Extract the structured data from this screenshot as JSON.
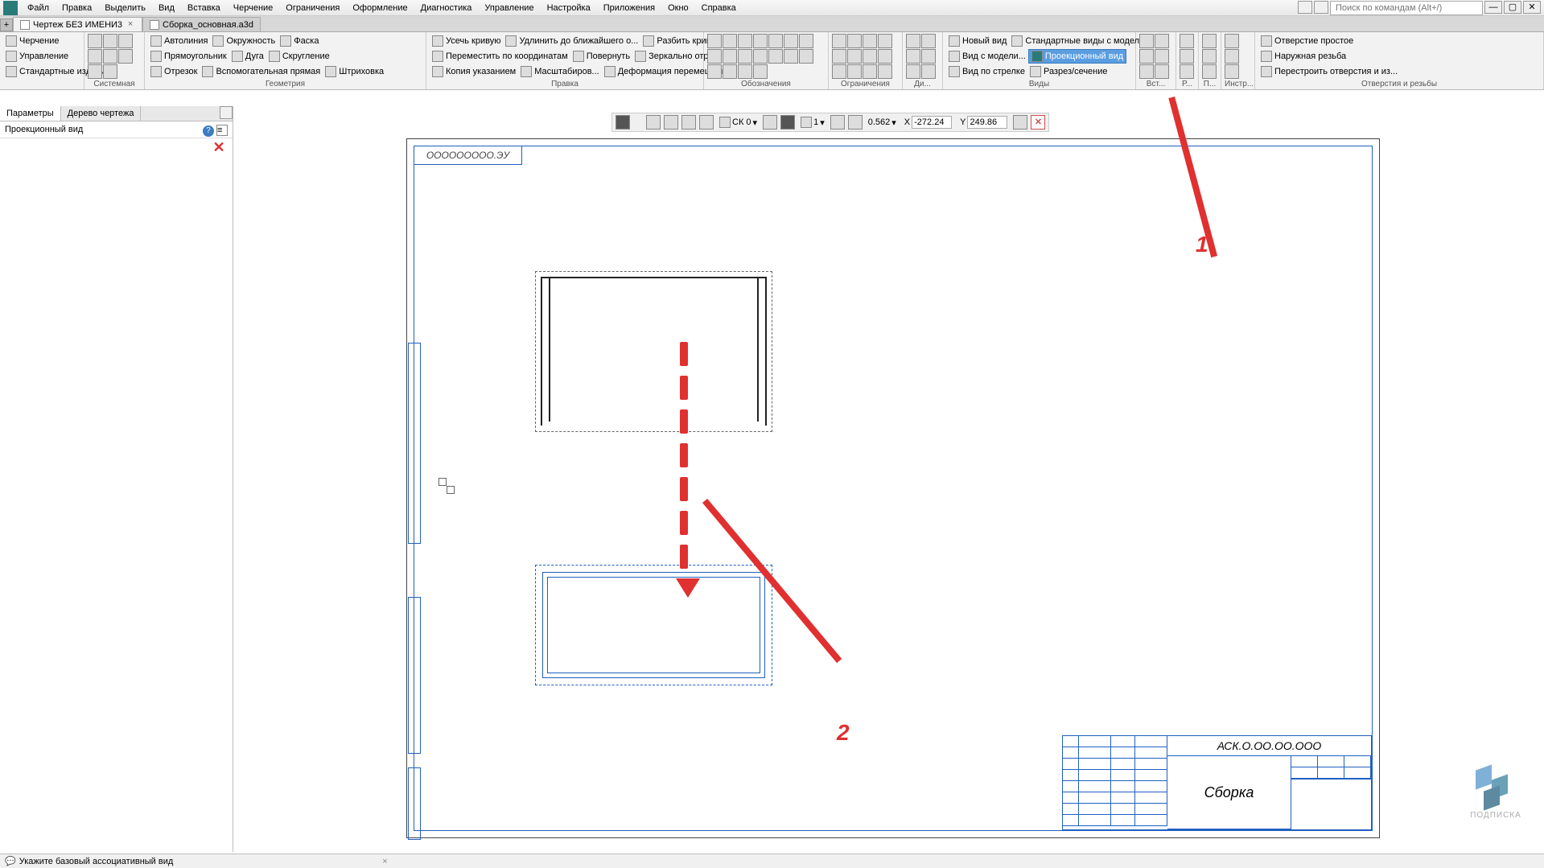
{
  "menu": {
    "file": "Файл",
    "edit": "Правка",
    "select": "Выделить",
    "view": "Вид",
    "insert": "Вставка",
    "drawing": "Черчение",
    "constraints": "Ограничения",
    "design": "Оформление",
    "diagnostics": "Диагностика",
    "manage": "Управление",
    "settings": "Настройка",
    "apps": "Приложения",
    "window": "Окно",
    "help": "Справка"
  },
  "search": {
    "placeholder": "Поиск по командам (Alt+/)"
  },
  "tabs": {
    "t1": "Чертеж БЕЗ ИМЕНИ3",
    "t2": "Сборка_основная.a3d"
  },
  "ribbon": {
    "sec_system": "Системная",
    "sec_geom": "Геометрия",
    "sec_edit": "Правка",
    "sec_annot": "Обозначения",
    "sec_constr": "Ограничения",
    "sec_diag": "Ди...",
    "sec_views": "Виды",
    "sec_ins": "Вст...",
    "sec_r": "Р...",
    "sec_p": "П...",
    "sec_tools": "Инстр...",
    "sec_holes": "Отверстия и резьбы",
    "draft": "Черчение",
    "manage": "Управление",
    "std_prod": "Стандартные изделия",
    "autoline": "Автолиния",
    "circle": "Окружность",
    "rect": "Прямоугольник",
    "arc": "Дуга",
    "segment": "Отрезок",
    "aux_line": "Вспомогательная прямая",
    "chamfer": "Фаска",
    "fillet": "Скругление",
    "hatch": "Штриховка",
    "trim": "Усечь кривую",
    "move_coord": "Переместить по координатам",
    "copy_ptr": "Копия указанием",
    "extend": "Удлинить до ближайшего о...",
    "rotate": "Повернуть",
    "scale": "Масштабиров...",
    "split": "Разбить кривую",
    "mirror": "Зеркально отразить",
    "deform": "Деформация перемещением",
    "new_view": "Новый вид",
    "model_view": "Вид с модели...",
    "arrow_view": "Вид по стрелке",
    "std_model_views": "Стандартные виды с модели...",
    "proj_view": "Проекционный вид",
    "section": "Разрез/сечение",
    "simple_hole": "Отверстие простое",
    "ext_thread": "Наружная резьба",
    "rebuild_holes": "Перестроить отверстия и из..."
  },
  "panels": {
    "params": "Параметры",
    "tree": "Дерево чертежа",
    "header": "Проекционный вид"
  },
  "secondary": {
    "cs": "СК 0",
    "step": "1",
    "zoom": "0.562",
    "x": "-272.24",
    "y": "249.86",
    "xl": "X",
    "yl": "Y"
  },
  "drawing": {
    "view_label": "ООООООООО.ЭУ",
    "tb_code": "АСК.О.ОО.ОО.ООО",
    "tb_name": "Сборка"
  },
  "annotations": {
    "l1": "1",
    "l2": "2"
  },
  "status": {
    "msg": "Укажите базовый ассоциативный вид"
  },
  "watermark": {
    "text": "ПОДПИСКА"
  }
}
